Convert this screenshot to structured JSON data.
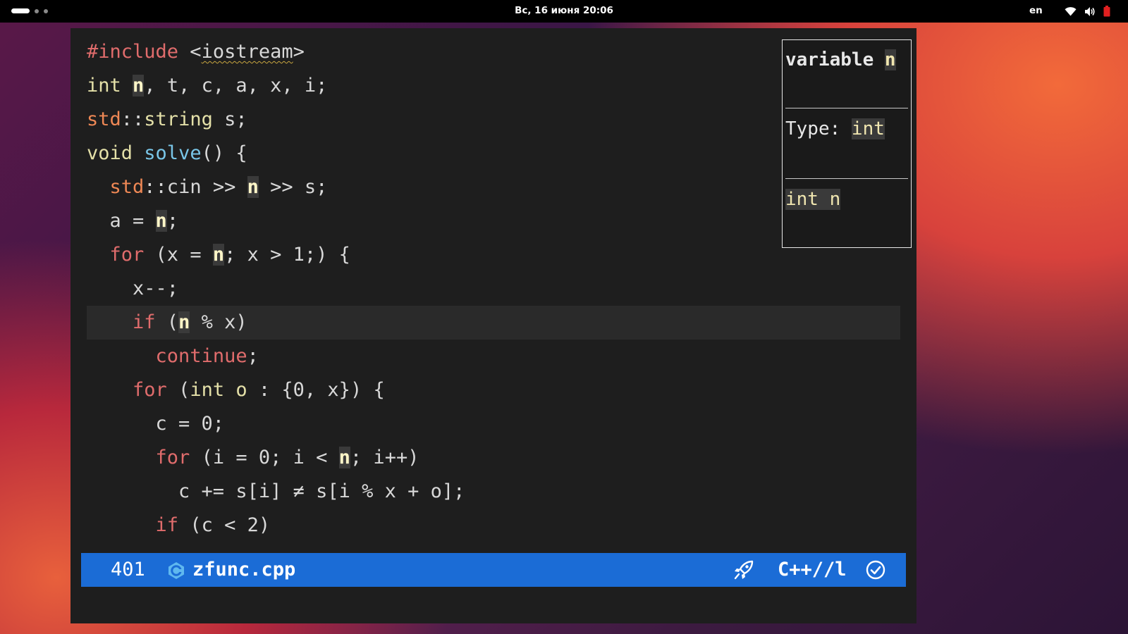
{
  "topbar": {
    "clock": "Вс, 16 июня  20:06",
    "lang": "en",
    "tray_icons": [
      "wifi-icon",
      "volume-icon",
      "battery-icon"
    ]
  },
  "editor": {
    "lines": [
      [
        {
          "t": "#include",
          "c": "kw-red"
        },
        {
          "t": " <",
          "c": "plain"
        },
        {
          "t": "iostream",
          "c": "plain underl"
        },
        {
          "t": ">",
          "c": "plain"
        }
      ],
      [
        {
          "t": "int",
          "c": "kw-yellow"
        },
        {
          "t": " ",
          "c": "plain"
        },
        {
          "t": "n",
          "c": "hl"
        },
        {
          "t": ", t, c, a, x, i;",
          "c": "plain"
        }
      ],
      [
        {
          "t": "std",
          "c": "kw-orange"
        },
        {
          "t": "::",
          "c": "plain"
        },
        {
          "t": "string",
          "c": "kw-yellow"
        },
        {
          "t": " s;",
          "c": "plain"
        }
      ],
      [
        {
          "t": "void",
          "c": "kw-yellow"
        },
        {
          "t": " ",
          "c": "plain"
        },
        {
          "t": "solve",
          "c": "fn"
        },
        {
          "t": "() {",
          "c": "plain"
        }
      ],
      [
        {
          "t": "  ",
          "c": "plain"
        },
        {
          "t": "std",
          "c": "kw-orange"
        },
        {
          "t": "::cin >> ",
          "c": "plain"
        },
        {
          "t": "n",
          "c": "hl"
        },
        {
          "t": " >> s;",
          "c": "plain"
        }
      ],
      [
        {
          "t": "  a = ",
          "c": "plain"
        },
        {
          "t": "n",
          "c": "hl"
        },
        {
          "t": ";",
          "c": "plain"
        }
      ],
      [
        {
          "t": "  ",
          "c": "plain"
        },
        {
          "t": "for",
          "c": "kw-red"
        },
        {
          "t": " (x = ",
          "c": "plain"
        },
        {
          "t": "n",
          "c": "hl"
        },
        {
          "t": "; x > 1;) {",
          "c": "plain"
        }
      ],
      [
        {
          "t": "    x--;",
          "c": "plain"
        }
      ],
      [
        {
          "t": "    ",
          "c": "plain"
        },
        {
          "t": "if",
          "c": "kw-red"
        },
        {
          "t": " (",
          "c": "plain"
        },
        {
          "t": "n",
          "c": "hl"
        },
        {
          "t": " % x)",
          "c": "plain"
        }
      ],
      [
        {
          "t": "      ",
          "c": "plain"
        },
        {
          "t": "continue",
          "c": "kw-red"
        },
        {
          "t": ";",
          "c": "plain"
        }
      ],
      [
        {
          "t": "    ",
          "c": "plain"
        },
        {
          "t": "for",
          "c": "kw-red"
        },
        {
          "t": " (",
          "c": "plain"
        },
        {
          "t": "int",
          "c": "kw-yellow"
        },
        {
          "t": " ",
          "c": "plain"
        },
        {
          "t": "o",
          "c": "kw-yellow"
        },
        {
          "t": " : {0, x}) {",
          "c": "plain"
        }
      ],
      [
        {
          "t": "      c = 0;",
          "c": "plain"
        }
      ],
      [
        {
          "t": "      ",
          "c": "plain"
        },
        {
          "t": "for",
          "c": "kw-red"
        },
        {
          "t": " (i = 0; i < ",
          "c": "plain"
        },
        {
          "t": "n",
          "c": "hl"
        },
        {
          "t": "; i++)",
          "c": "plain"
        }
      ],
      [
        {
          "t": "        c += s[i] ≠ s[i % x + o];",
          "c": "plain"
        }
      ],
      [
        {
          "t": "      ",
          "c": "plain"
        },
        {
          "t": "if",
          "c": "kw-red"
        },
        {
          "t": " (c < 2)",
          "c": "plain"
        }
      ]
    ],
    "current_line_index": 8
  },
  "hover": {
    "title_prefix": "variable ",
    "title_name": "n",
    "type_label": "Type: ",
    "type_value": "int",
    "declaration": "int n"
  },
  "statusbar": {
    "line_number": "401",
    "filename": "zfunc.cpp",
    "mode": "C++//l",
    "file_icon": "cpp-file-icon",
    "lsp_icon": "rocket-icon",
    "diagnostics_icon": "check-circle-icon",
    "bg_color": "#1b6cd6"
  }
}
